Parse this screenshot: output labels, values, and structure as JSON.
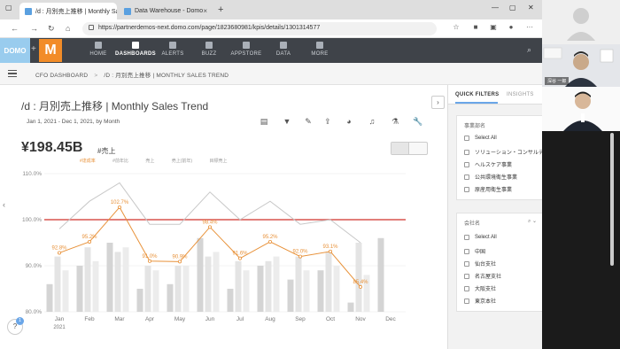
{
  "browser": {
    "tabs": [
      {
        "label": "/d : 月別売上推移 | Monthly Sales",
        "active": true
      },
      {
        "label": "Data Warehouse - Domo",
        "active": false
      }
    ],
    "url": "https://partnerdemos-next.domo.com/page/1823680981/kpis/details/1301314577"
  },
  "nav": {
    "logo_text": "DOMO",
    "m_logo": "M",
    "items": [
      {
        "label": "HOME",
        "active": false
      },
      {
        "label": "DASHBOARDS",
        "active": true
      },
      {
        "label": "ALERTS",
        "active": false
      },
      {
        "label": "BUZZ",
        "active": false
      },
      {
        "label": "APPSTORE",
        "active": false
      },
      {
        "label": "DATA",
        "active": false
      },
      {
        "label": "MORE",
        "active": false
      }
    ]
  },
  "breadcrumb": {
    "parent": "CFO DASHBOARD",
    "separator": ">",
    "current": "/D : 月別売上推移 | MONTHLY SALES TREND"
  },
  "card": {
    "title": "/d : 月別売上推移 | Monthly Sales Trend",
    "date_range": "Jan 1, 2021 - Dec 1, 2021, by Month",
    "summary_value": "¥198.45B",
    "summary_label": "#売上",
    "legend": [
      "#達成率",
      "#前年比",
      "売上",
      "売上(前年)",
      "目標売上"
    ]
  },
  "side_panel": {
    "tabs": [
      "QUICK FILTERS",
      "INSIGHTS"
    ],
    "filters": [
      {
        "header": "事業部名",
        "options": [
          "Select All",
          "ソリューション・コンサルティング事...",
          "ヘルスケア事業",
          "公共環境衛生事業",
          "原産用衛生事業"
        ]
      },
      {
        "header": "会社名",
        "options": [
          "Select All",
          "中国",
          "仙台支社",
          "名古屋支社",
          "大阪支社",
          "東京本社"
        ]
      }
    ]
  },
  "video": {
    "participant_label": "深谷 一郎"
  },
  "colors": {
    "accent_line": "#e8923a",
    "target_line": "#d9534f",
    "bars": "#dcdcdc",
    "nav_bg": "#3f4349",
    "domo_orange": "#f28c28",
    "domo_blue": "#99ccee"
  },
  "chart_data": {
    "type": "bar",
    "categories": [
      "Jan",
      "Feb",
      "Mar",
      "Apr",
      "May",
      "Jun",
      "Jul",
      "Aug",
      "Sep",
      "Oct",
      "Nov",
      "Dec"
    ],
    "x_sublabel": "2021",
    "ylim": [
      80,
      110
    ],
    "yticks": [
      "80.0%",
      "90.0%",
      "100.0%",
      "110.0%"
    ],
    "target_line": 100,
    "series": [
      {
        "name": "#達成率",
        "type": "line",
        "values": [
          92.8,
          95.2,
          102.7,
          91.0,
          90.9,
          98.4,
          91.6,
          95.2,
          92.0,
          93.1,
          85.4,
          null
        ],
        "labels": [
          "92.8%",
          "95.2%",
          "102.7%",
          "91.0%",
          "90.9%",
          "98.4%",
          "91.6%",
          "95.2%",
          "92.0%",
          "93.1%",
          "85.4%",
          ""
        ]
      },
      {
        "name": "#前年比",
        "type": "line",
        "values": [
          98,
          104,
          108,
          99,
          99,
          106,
          100,
          104,
          99,
          100,
          95,
          null
        ]
      },
      {
        "name": "売上",
        "type": "bar",
        "values": [
          86,
          90,
          95,
          85,
          86,
          96,
          85,
          90,
          87,
          89,
          82,
          96
        ]
      },
      {
        "name": "売上(前年)",
        "type": "bar",
        "values": [
          92,
          94,
          93,
          90,
          90,
          92,
          91,
          91,
          92,
          93,
          95,
          null
        ]
      },
      {
        "name": "目標売上",
        "type": "bar",
        "values": [
          89,
          91,
          94,
          89,
          90,
          93,
          89,
          92,
          89,
          90,
          88,
          null
        ]
      }
    ]
  }
}
